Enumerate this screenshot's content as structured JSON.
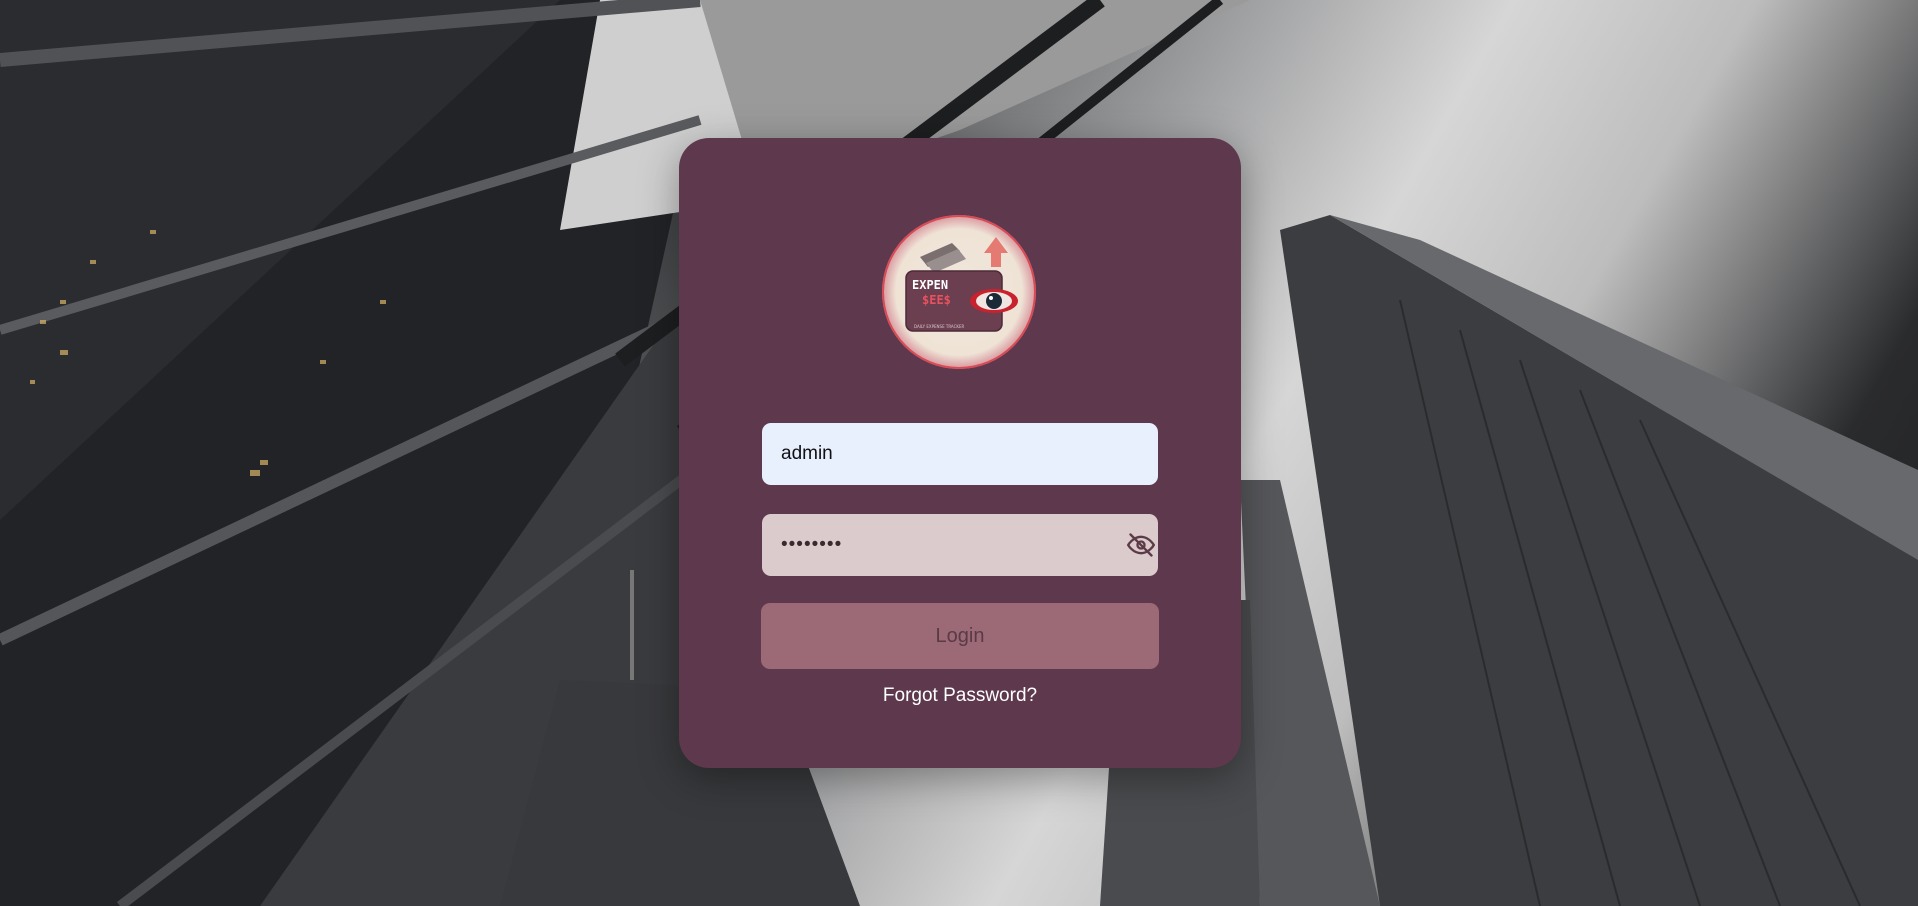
{
  "login": {
    "username_value": "admin",
    "password_value": "••••••••",
    "login_label": "Login",
    "forgot_label": "Forgot Password?"
  },
  "logo": {
    "text_line1": "EXPEN",
    "text_line2": "$EE$",
    "tagline": "DAILY EXPENSE TRACKER"
  },
  "icons": {
    "password_toggle": "eye-slash-icon"
  },
  "colors": {
    "card": "#5e384c",
    "username_bg": "#e8f0fe",
    "password_bg": "#dccbcc",
    "button_bg": "#9b6a76",
    "button_text": "#5a3a47",
    "link": "#ffffff"
  }
}
